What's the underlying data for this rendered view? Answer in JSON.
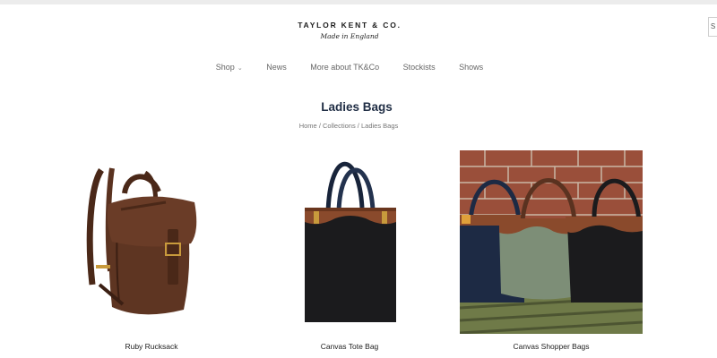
{
  "brand": {
    "name": "TAYLOR KENT & CO.",
    "tagline": "Made in England"
  },
  "side_tab": {
    "label": "S"
  },
  "nav": [
    {
      "label": "Shop",
      "has_dropdown": true
    },
    {
      "label": "News"
    },
    {
      "label": "More about TK&Co"
    },
    {
      "label": "Stockists"
    },
    {
      "label": "Shows"
    }
  ],
  "page": {
    "title": "Ladies Bags"
  },
  "breadcrumb": {
    "home": "Home",
    "collections": "Collections",
    "current": "Ladies Bags",
    "separator": "/"
  },
  "products": [
    {
      "name": "Ruby Rucksack"
    },
    {
      "name": "Canvas Tote Bag"
    },
    {
      "name": "Canvas Shopper Bags"
    }
  ],
  "colors": {
    "title": "#1f2d44",
    "leather": "#5a3220",
    "canvas_black": "#1b1b1d",
    "canvas_navy": "#1d2a44",
    "canvas_sage": "#7d8e77",
    "brick": "#9a4f3a"
  }
}
